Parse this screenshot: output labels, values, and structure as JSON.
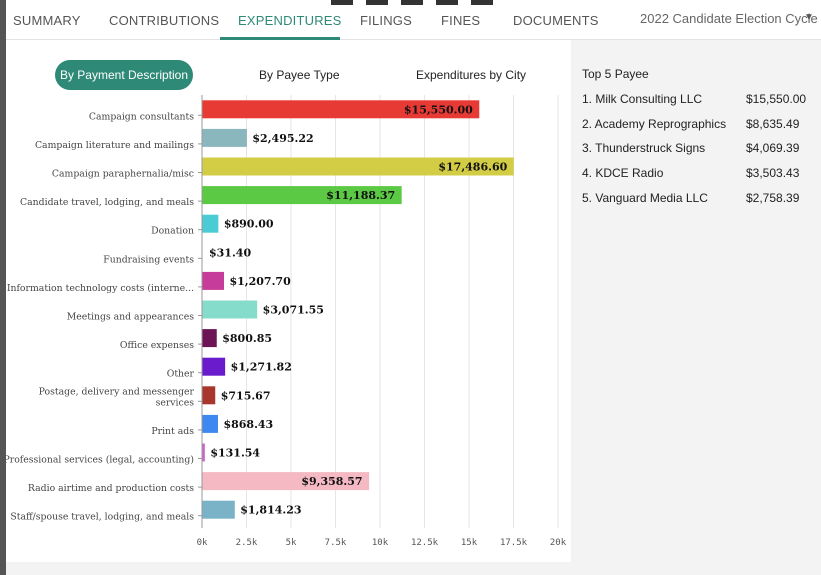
{
  "nav": {
    "tabs": [
      "SUMMARY",
      "CONTRIBUTIONS",
      "EXPENDITURES",
      "FILINGS",
      "FINES",
      "DOCUMENTS"
    ],
    "active": "EXPENDITURES",
    "cycle_select": "2022 Candidate Election Cycle"
  },
  "subtabs": {
    "items": [
      "By Payment Description",
      "By Payee Type",
      "Expenditures by City"
    ],
    "active": "By Payment Description"
  },
  "top_payees": {
    "title": "Top 5 Payee",
    "items": [
      {
        "name": "1. Milk Consulting LLC",
        "amount": "$15,550.00"
      },
      {
        "name": "2. Academy Reprographics",
        "amount": "$8,635.49"
      },
      {
        "name": "3. Thunderstruck Signs",
        "amount": "$4,069.39"
      },
      {
        "name": "4. KDCE Radio",
        "amount": "$3,503.43"
      },
      {
        "name": "5. Vanguard Media LLC",
        "amount": "$2,758.39"
      }
    ]
  },
  "colors": {
    "accent": "#2e8a76"
  },
  "chart_data": {
    "type": "bar",
    "orientation": "horizontal",
    "categories": [
      "Campaign consultants",
      "Campaign literature and mailings",
      "Campaign paraphernalia/misc",
      "Candidate travel, lodging, and meals",
      "Donation",
      "Fundraising events",
      "Information technology costs (interne...",
      "Meetings and appearances",
      "Office expenses",
      "Other",
      "Postage, delivery and messenger services",
      "Print ads",
      "Professional services (legal, accounting)",
      "Radio airtime and production costs",
      "Staff/spouse travel, lodging, and meals"
    ],
    "values": [
      15550.0,
      2495.22,
      17486.6,
      11188.37,
      890.0,
      31.4,
      1207.7,
      3071.55,
      800.85,
      1271.82,
      715.67,
      868.43,
      131.54,
      9358.57,
      1814.23
    ],
    "value_labels": [
      "$15,550.00",
      "$2,495.22",
      "$17,486.60",
      "$11,188.37",
      "$890.00",
      "$31.40",
      "$1,207.70",
      "$3,071.55",
      "$800.85",
      "$1,271.82",
      "$715.67",
      "$868.43",
      "$131.54",
      "$9,358.57",
      "$1,814.23"
    ],
    "colors": [
      "#e83a35",
      "#8ab6bd",
      "#d3cc45",
      "#5cc944",
      "#4bcbd3",
      "#ffffff",
      "#c63c9a",
      "#85dccb",
      "#6d1456",
      "#6a1ccc",
      "#a8362c",
      "#3f88f0",
      "#cc66cc",
      "#f4b9c3",
      "#7ab3c8"
    ],
    "label_inside": [
      true,
      false,
      true,
      true,
      false,
      false,
      false,
      false,
      false,
      false,
      false,
      false,
      false,
      true,
      false
    ],
    "x_ticks": [
      "0k",
      "2.5k",
      "5k",
      "7.5k",
      "10k",
      "12.5k",
      "15k",
      "17.5k",
      "20k"
    ],
    "xlim": [
      0,
      20000
    ],
    "grid": true,
    "title": "",
    "xlabel": "",
    "ylabel": ""
  }
}
